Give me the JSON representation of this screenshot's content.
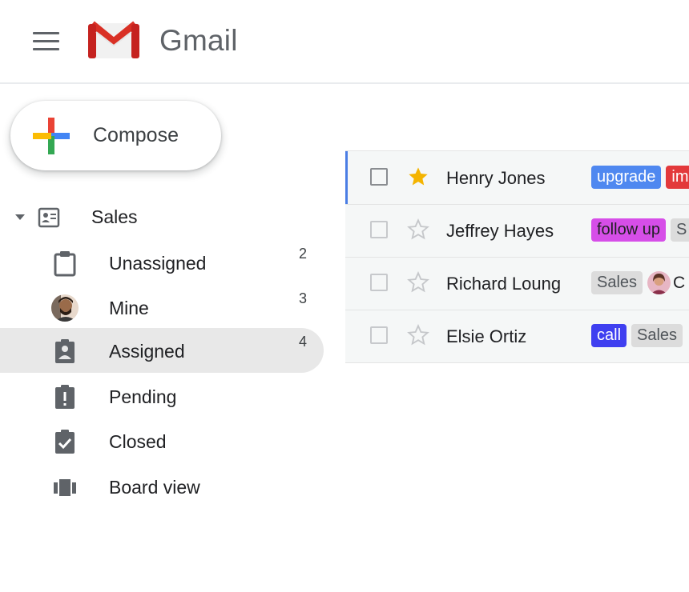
{
  "app": {
    "brand": "Gmail"
  },
  "compose": {
    "label": "Compose"
  },
  "sidebar": {
    "group": {
      "label": "Sales"
    },
    "items": [
      {
        "label": "Unassigned",
        "count": "2",
        "icon": "clipboard-icon"
      },
      {
        "label": "Mine",
        "count": "3",
        "icon": "user-avatar"
      },
      {
        "label": "Assigned",
        "count": "4",
        "icon": "assigned-clipboard-icon",
        "active": true
      },
      {
        "label": "Pending",
        "count": "",
        "icon": "pending-clipboard-icon"
      },
      {
        "label": "Closed",
        "count": "",
        "icon": "check-clipboard-icon"
      },
      {
        "label": "Board view",
        "count": "",
        "icon": "board-view-icon"
      }
    ]
  },
  "mail": {
    "rows": [
      {
        "sender": "Henry Jones",
        "starred": true,
        "labels": [
          "upgrade",
          "im"
        ]
      },
      {
        "sender": "Jeffrey Hayes",
        "starred": false,
        "labels": [
          "follow up",
          "S"
        ]
      },
      {
        "sender": "Richard Loung",
        "starred": false,
        "labels": [
          "Sales",
          "C"
        ]
      },
      {
        "sender": "Elsie Ortiz",
        "starred": false,
        "labels": [
          "call",
          "Sales"
        ]
      }
    ]
  },
  "colors": {
    "star": "#f4b400",
    "active_bar": "#4a7de4",
    "upgrade": "#4f88f0",
    "important": "#e3393b",
    "follow_up": "#d64ee8",
    "call": "#3f3ff0",
    "sales": "#dcdcdc"
  }
}
